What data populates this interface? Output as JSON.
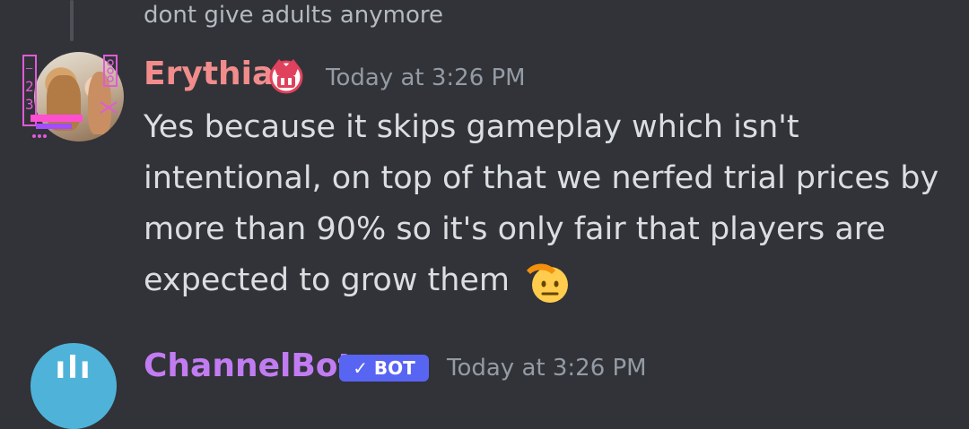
{
  "previous_message": {
    "text": "dont give adults anymore"
  },
  "message": {
    "author": "Erythia",
    "author_color": "#f28c8c",
    "badge_icon": "crown-role-icon",
    "timestamp": "Today at 3:26 PM",
    "text": "Yes because it skips gameplay which isn't intentional, on top of that we nerfed trial prices by more than 90% so it's only fair that players are expected to grow them",
    "emoji": "saluting-face-emoji",
    "avatar_icon": "user-avatar"
  },
  "next_message": {
    "author": "ChannelBot",
    "author_color": "#c27cf2",
    "bot_tag": "✓ BOT",
    "timestamp": "Today at 3:26 PM",
    "avatar_glyph": "ılı"
  }
}
